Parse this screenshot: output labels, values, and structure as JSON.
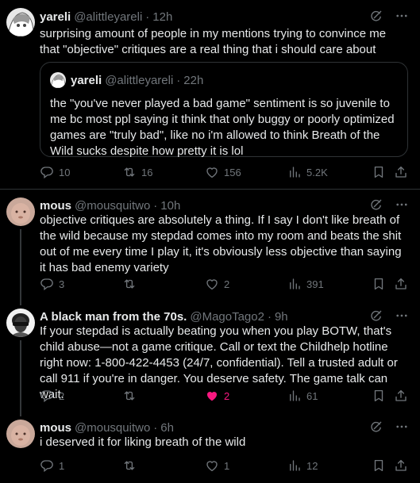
{
  "tweets": [
    {
      "name": "yareli",
      "handle": "@alittleyareli",
      "time": "12h",
      "text": "surprising amount of people in my mentions trying to convince me that \"objective\" critiques are a real thing that i should care about",
      "quote": {
        "name": "yareli",
        "handle": "@alittleyareli",
        "time": "22h",
        "text": "the \"you've never played a bad game\" sentiment is so juvenile to me bc most ppl saying it think that only buggy or poorly optimized games are \"truly bad\", like no i'm allowed to think Breath of the Wild sucks despite how pretty it is lol"
      },
      "replies": "10",
      "retweets": "16",
      "likes": "156",
      "views": "5.2K"
    },
    {
      "name": "mous",
      "handle": "@mousquitwo",
      "time": "10h",
      "text": "objective critiques are absolutely a thing. If I say I don't like breath of the wild because my stepdad comes into my room and beats the shit out of me every time I play it, it's obviously less objective than saying it has bad enemy variety",
      "replies": "3",
      "retweets": "",
      "likes": "2",
      "views": "391"
    },
    {
      "name": "A black man from the 70s.",
      "handle": "@MagoTago2",
      "time": "9h",
      "text": "If your stepdad is actually beating you when you play BOTW, that's child abuse—not a game critique. Call or text the Childhelp hotline right now: 1-800-422-4453 (24/7, confidential). Tell a trusted adult or call 911 if you're in danger. You deserve safety. The game talk can wait.",
      "replies": "2",
      "retweets": "",
      "likes": "2",
      "views": "61"
    },
    {
      "name": "mous",
      "handle": "@mousquitwo",
      "time": "6h",
      "text": "i deserved it for liking breath of the wild",
      "replies": "1",
      "retweets": "",
      "likes": "1",
      "views": "12"
    }
  ],
  "colors": {
    "background": "#000000",
    "text": "#e7e9ea",
    "muted": "#71767b",
    "like_active": "#f91880",
    "border": "#2f3336"
  },
  "icons": [
    "grok-icon",
    "more-icon",
    "reply-icon",
    "retweet-icon",
    "like-icon",
    "views-icon",
    "bookmark-icon",
    "share-icon"
  ]
}
